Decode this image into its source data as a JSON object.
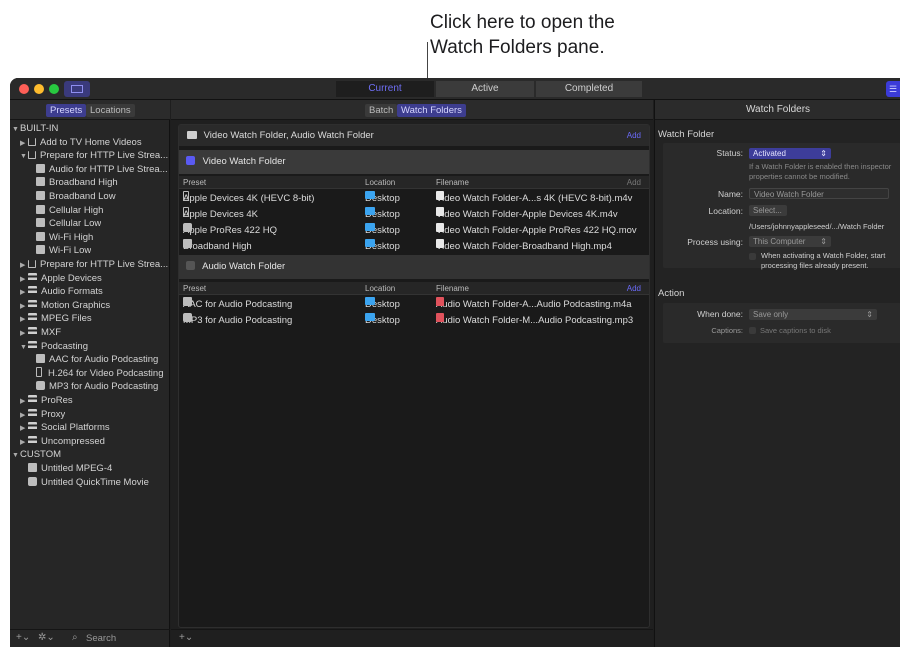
{
  "callout": {
    "line1": "Click here to open the",
    "line2": "Watch Folders pane."
  },
  "titlebar": {
    "tabs": [
      "Current",
      "Active",
      "Completed"
    ],
    "colors": {
      "close": "#fe5f57",
      "minimize": "#febc2e",
      "zoom": "#28c840",
      "accent": "#6a6af8"
    }
  },
  "sidebar": {
    "tabs": [
      "Presets",
      "Locations"
    ],
    "items": [
      {
        "label": "BUILT-IN",
        "indent": 0,
        "tw": "▼",
        "icon": ""
      },
      {
        "label": "Add to TV Home Videos",
        "indent": 1,
        "tw": "▶",
        "icon": "share"
      },
      {
        "label": "Prepare for HTTP Live Strea...",
        "indent": 1,
        "tw": "▼",
        "icon": "share"
      },
      {
        "label": "Audio for HTTP Live Strea...",
        "indent": 2,
        "tw": "",
        "icon": "fmt"
      },
      {
        "label": "Broadband High",
        "indent": 2,
        "tw": "",
        "icon": "fmt"
      },
      {
        "label": "Broadband Low",
        "indent": 2,
        "tw": "",
        "icon": "fmt"
      },
      {
        "label": "Cellular High",
        "indent": 2,
        "tw": "",
        "icon": "fmt"
      },
      {
        "label": "Cellular Low",
        "indent": 2,
        "tw": "",
        "icon": "fmt"
      },
      {
        "label": "Wi-Fi High",
        "indent": 2,
        "tw": "",
        "icon": "fmt"
      },
      {
        "label": "Wi-Fi Low",
        "indent": 2,
        "tw": "",
        "icon": "fmt"
      },
      {
        "label": "Prepare for HTTP Live Strea...",
        "indent": 1,
        "tw": "▶",
        "icon": "share"
      },
      {
        "label": "Apple Devices",
        "indent": 1,
        "tw": "▶",
        "icon": "grp"
      },
      {
        "label": "Audio Formats",
        "indent": 1,
        "tw": "▶",
        "icon": "grp"
      },
      {
        "label": "Motion Graphics",
        "indent": 1,
        "tw": "▶",
        "icon": "grp"
      },
      {
        "label": "MPEG Files",
        "indent": 1,
        "tw": "▶",
        "icon": "grp"
      },
      {
        "label": "MXF",
        "indent": 1,
        "tw": "▶",
        "icon": "grp"
      },
      {
        "label": "Podcasting",
        "indent": 1,
        "tw": "▼",
        "icon": "grp"
      },
      {
        "label": "AAC for Audio Podcasting",
        "indent": 2,
        "tw": "",
        "icon": "fmt"
      },
      {
        "label": "H.264 for Video Podcasting",
        "indent": 2,
        "tw": "",
        "icon": "phone"
      },
      {
        "label": "MP3 for Audio Podcasting",
        "indent": 2,
        "tw": "",
        "icon": "qt"
      },
      {
        "label": "ProRes",
        "indent": 1,
        "tw": "▶",
        "icon": "grp"
      },
      {
        "label": "Proxy",
        "indent": 1,
        "tw": "▶",
        "icon": "grp"
      },
      {
        "label": "Social Platforms",
        "indent": 1,
        "tw": "▶",
        "icon": "grp"
      },
      {
        "label": "Uncompressed",
        "indent": 1,
        "tw": "▶",
        "icon": "grp"
      },
      {
        "label": "CUSTOM",
        "indent": 0,
        "tw": "▼",
        "icon": ""
      },
      {
        "label": "Untitled MPEG-4",
        "indent": 1,
        "tw": "",
        "icon": "fmt"
      },
      {
        "label": "Untitled QuickTime Movie",
        "indent": 1,
        "tw": "",
        "icon": "qt"
      }
    ],
    "bottom": {
      "add": "+⌄",
      "action": "✲⌄",
      "search_placeholder": "Search"
    }
  },
  "center": {
    "tabs": [
      "Batch",
      "Watch Folders"
    ],
    "header_title": "Video Watch Folder, Audio Watch Folder",
    "add_label": "Add",
    "columns": {
      "preset": "Preset",
      "location": "Location",
      "filename": "Filename",
      "add": "Add"
    },
    "video": {
      "title": "Video Watch Folder",
      "rows": [
        {
          "preset": "Apple Devices 4K (HEVC 8-bit)",
          "location": "Desktop",
          "filename": "Video Watch Folder-A...s 4K (HEVC 8-bit).m4v",
          "picon": "phone"
        },
        {
          "preset": "Apple Devices 4K",
          "location": "Desktop",
          "filename": "Video Watch Folder-Apple Devices 4K.m4v",
          "picon": "phone"
        },
        {
          "preset": "Apple ProRes 422 HQ",
          "location": "Desktop",
          "filename": "Video Watch Folder-Apple ProRes 422 HQ.mov",
          "picon": "qt"
        },
        {
          "preset": "Broadband High",
          "location": "Desktop",
          "filename": "Video Watch Folder-Broadband High.mp4",
          "picon": "fmt"
        }
      ]
    },
    "audio": {
      "title": "Audio Watch Folder",
      "rows": [
        {
          "preset": "AAC for Audio Podcasting",
          "location": "Desktop",
          "filename": "Audio Watch Folder-A...Audio Podcasting.m4a",
          "picon": "fmt"
        },
        {
          "preset": "MP3 for Audio Podcasting",
          "location": "Desktop",
          "filename": "Audio Watch Folder-M...Audio Podcasting.mp3",
          "picon": "qt"
        }
      ]
    },
    "bottom_add": "+⌄"
  },
  "inspector": {
    "title": "Watch Folders",
    "watch_folder_label": "Watch Folder",
    "status_label": "Status:",
    "status_value": "Activated",
    "status_note": "If a Watch Folder is enabled then inspector properties cannot be modified.",
    "name_label": "Name:",
    "name_value": "Video Watch Folder",
    "location_label": "Location:",
    "location_button": "Select...",
    "location_path": "/Users/johnnyappleseed/.../Watch Folder",
    "process_label": "Process using:",
    "process_value": "This Computer",
    "start_note": "When activating a Watch Folder, start processing files already present.",
    "action_label": "Action",
    "when_done_label": "When done:",
    "when_done_value": "Save only",
    "captions_label": "Captions:",
    "captions_value": "Save captions to disk"
  }
}
